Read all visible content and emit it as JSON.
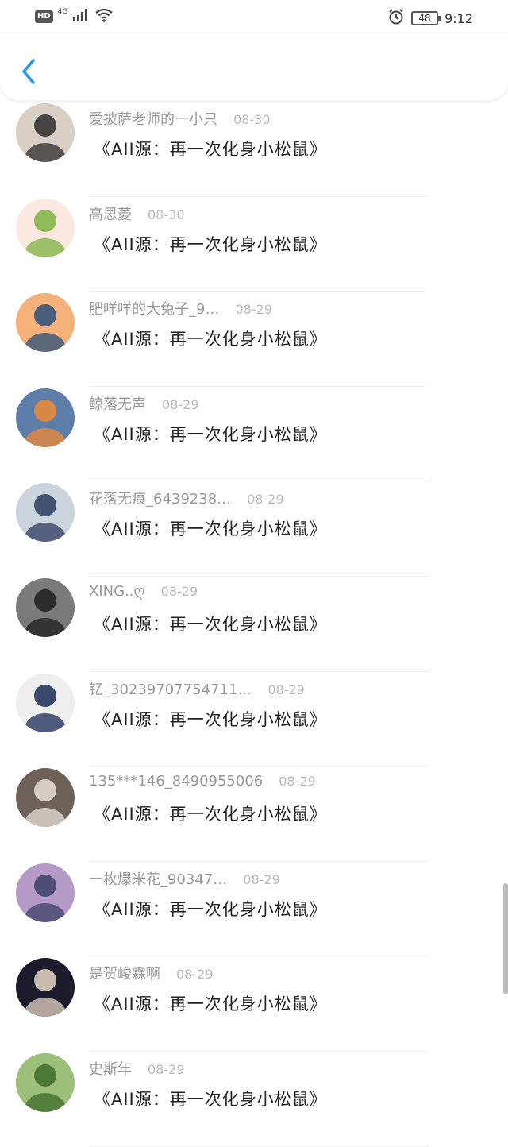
{
  "status_bar": {
    "hd": "HD",
    "network": "4G",
    "battery": "48",
    "time": "9:12"
  },
  "header": {
    "back_icon": "chevron-left-icon",
    "accent": "#2196f3"
  },
  "items": [
    {
      "user": "爱披萨老师的一小只",
      "date": "08-30",
      "title": "《AII源：再一次化身小松鼠》",
      "avatar_bg": "#d9cfc5",
      "avatar_fg": "#2b2b2b"
    },
    {
      "user": "高思菱",
      "date": "08-30",
      "title": "《AII源：再一次化身小松鼠》",
      "avatar_bg": "#fbe9df",
      "avatar_fg": "#7cb342"
    },
    {
      "user": "肥咩咩的大兔子_9…",
      "date": "08-29",
      "title": "《AII源：再一次化身小松鼠》",
      "avatar_bg": "#f4b27a",
      "avatar_fg": "#2a4f7a"
    },
    {
      "user": "鲸落无声",
      "date": "08-29",
      "title": "《AII源：再一次化身小松鼠》",
      "avatar_bg": "#5c7ea8",
      "avatar_fg": "#f08a34"
    },
    {
      "user": "花落无痕_6439238…",
      "date": "08-29",
      "title": "《AII源：再一次化身小松鼠》",
      "avatar_bg": "#cbd3dc",
      "avatar_fg": "#2d3b60"
    },
    {
      "user": "XING..ღ",
      "date": "08-29",
      "title": "《AII源：再一次化身小松鼠》",
      "avatar_bg": "#7a7a7a",
      "avatar_fg": "#1e1e1e"
    },
    {
      "user": "钇_30239707754711…",
      "date": "08-29",
      "title": "《AII源：再一次化身小松鼠》",
      "avatar_bg": "#eeeeee",
      "avatar_fg": "#1a2a55"
    },
    {
      "user": "135***146_8490955006",
      "date": "08-29",
      "title": "《AII源：再一次化身小松鼠》",
      "avatar_bg": "#6e6157",
      "avatar_fg": "#e8e0d8"
    },
    {
      "user": "一枚爆米花_90347…",
      "date": "08-29",
      "title": "《AII源：再一次化身小松鼠》",
      "avatar_bg": "#b59ac8",
      "avatar_fg": "#3c3f66"
    },
    {
      "user": "是贺峻霖啊",
      "date": "08-29",
      "title": "《AII源：再一次化身小松鼠》",
      "avatar_bg": "#1b1b2b",
      "avatar_fg": "#e6d6c6"
    },
    {
      "user": "史斯年",
      "date": "08-29",
      "title": "《AII源：再一次化身小松鼠》",
      "avatar_bg": "#9cc07a",
      "avatar_fg": "#3e6b2b"
    }
  ]
}
